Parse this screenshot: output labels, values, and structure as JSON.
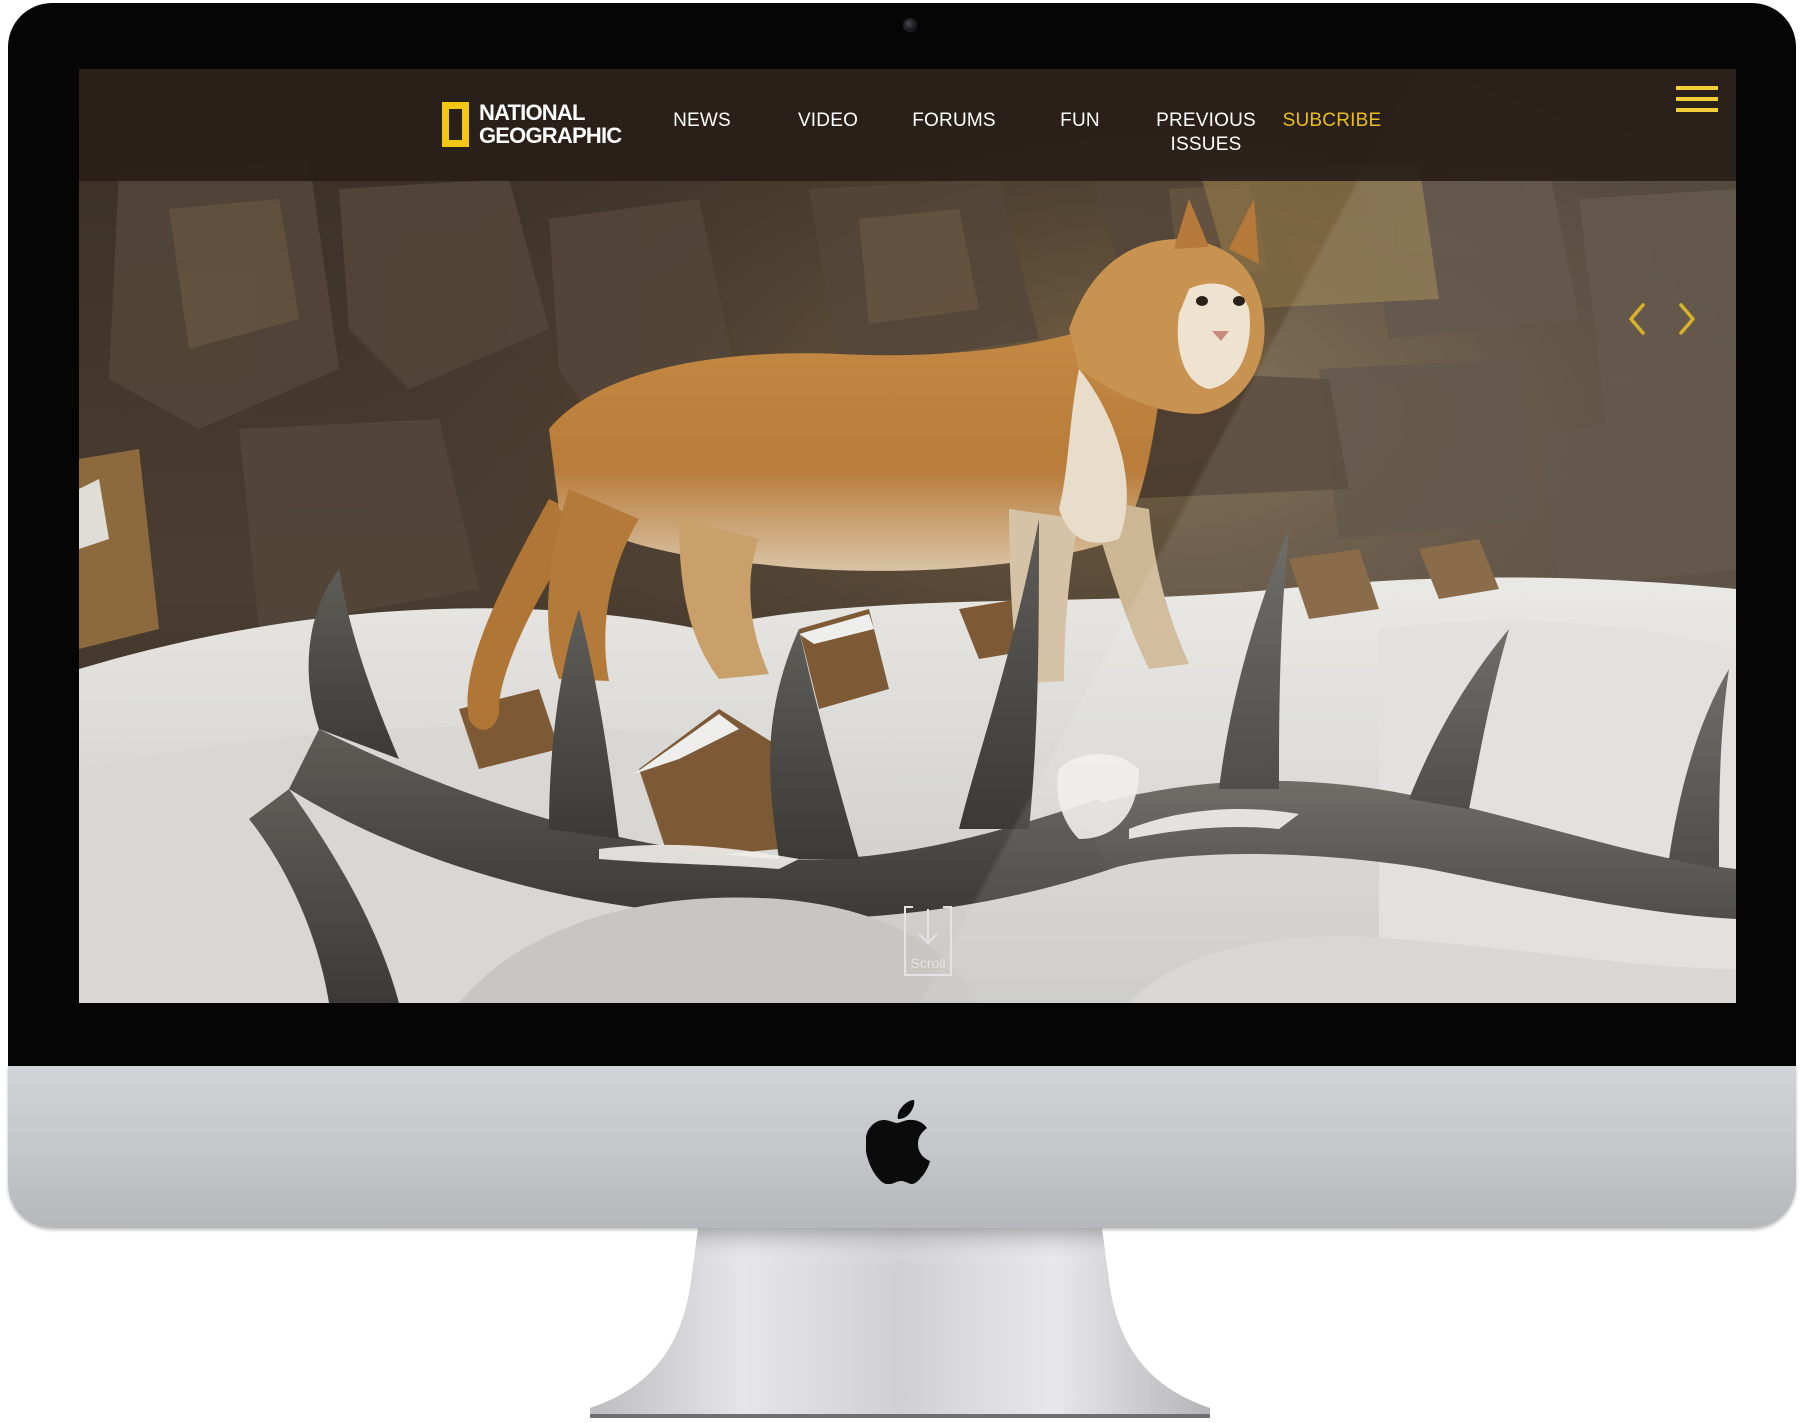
{
  "site": {
    "brand": {
      "line1": "NATIONAL",
      "line2": "GEOGRAPHIC",
      "accent_color": "#f3c614"
    },
    "nav": {
      "items": [
        {
          "label": "NEWS"
        },
        {
          "label": "VIDEO"
        },
        {
          "label": "FORUMS"
        },
        {
          "label": "FUN"
        },
        {
          "label": "PREVIOUS",
          "label2": "ISSUES"
        },
        {
          "label": "SUBCRIBE",
          "highlight": true
        }
      ],
      "highlight_color": "#e8bf1a",
      "bar_color": "#281e18"
    },
    "hero": {
      "subject": "mountain lion in snowy rocky cave with elk antlers in foreground"
    },
    "controls": {
      "prev_icon": "chevron-left-icon",
      "next_icon": "chevron-right-icon",
      "menu_icon": "hamburger-menu-icon",
      "scroll_label": "Scroll",
      "scroll_icon": "arrow-down-icon"
    }
  },
  "device": {
    "logo_icon": "apple-logo-icon"
  }
}
